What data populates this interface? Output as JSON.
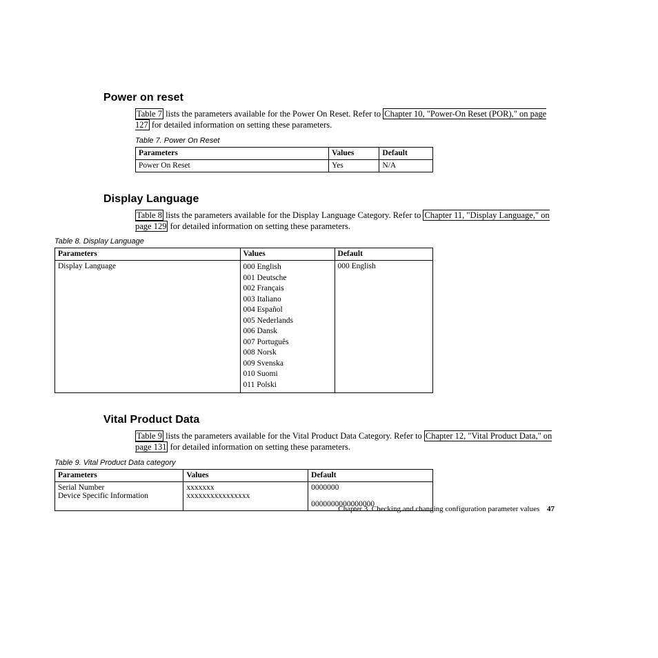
{
  "section1": {
    "heading": "Power on reset",
    "para_pre": "",
    "link1": "Table 7",
    "para_mid1": " lists the parameters available for the Power On Reset. Refer to ",
    "link2": "Chapter 10, \"Power-On Reset (POR),\" on page 127",
    "para_post": " for detailed information on setting these parameters.",
    "caption": "Table 7. Power On Reset",
    "headers": {
      "c1": "Parameters",
      "c2": "Values",
      "c3": "Default"
    },
    "row": {
      "c1": "Power On Reset",
      "c2": "Yes",
      "c3": "N/A"
    }
  },
  "section2": {
    "heading": "Display Language",
    "link1": "Table 8",
    "para_mid1": " lists the parameters available for the Display Language Category. Refer to ",
    "link2": "Chapter 11, \"Display Language,\" on page 129",
    "para_post": " for detailed information on setting these parameters.",
    "caption": "Table 8. Display Language",
    "headers": {
      "c1": "Parameters",
      "c2": "Values",
      "c3": "Default"
    },
    "row": {
      "c1": "Display Language",
      "values": {
        "v0": "000 English",
        "v1": "001 Deutsche",
        "v2": "002 Français",
        "v3": "003 Italiano",
        "v4": "004 Español",
        "v5": "005 Nederlands",
        "v6": "006 Dansk",
        "v7": "007 Português",
        "v8": "008 Norsk",
        "v9": "009 Svenska",
        "v10": "010 Suomi",
        "v11": "011 Polski"
      },
      "c3": "000 English"
    }
  },
  "section3": {
    "heading": "Vital Product Data",
    "link1": "Table 9",
    "para_mid1": " lists the parameters available for the Vital Product Data Category. Refer to ",
    "link2": "Chapter 12, \"Vital Product Data,\" on page 131",
    "para_post": " for detailed information on setting these parameters.",
    "caption": "Table 9. Vital Product Data category",
    "headers": {
      "c1": "Parameters",
      "c2": "Values",
      "c3": "Default"
    },
    "row": {
      "p1": "Serial Number",
      "p2": "Device Specific Information",
      "v1": "xxxxxxx",
      "v2": "xxxxxxxxxxxxxxxx",
      "d1": "0000000",
      "d2": "0000000000000000"
    }
  },
  "footer": {
    "chapter": "Chapter 3. Checking and changing configuration parameter values",
    "page": "47"
  }
}
